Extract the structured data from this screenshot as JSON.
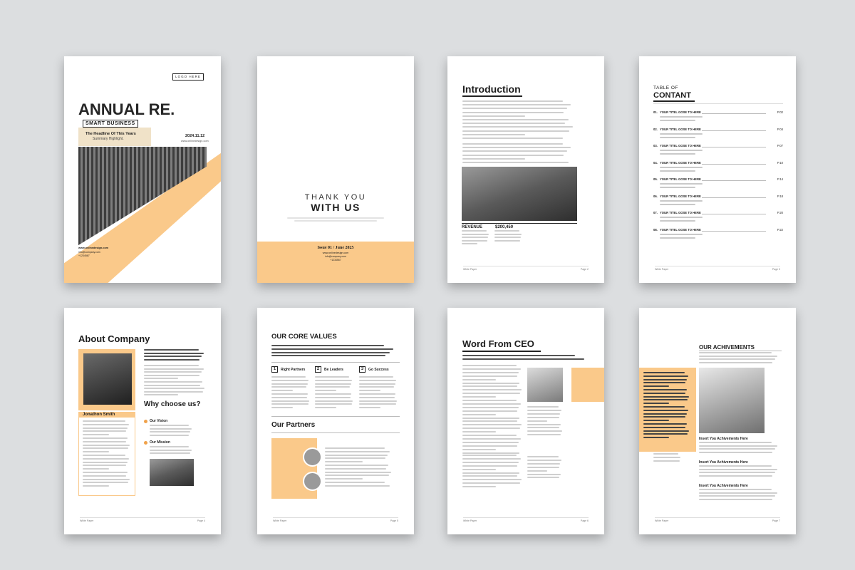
{
  "colors": {
    "accent": "#fac98a",
    "bg": "#dcdee0",
    "dark": "#1d1d1d"
  },
  "cover": {
    "logo": "LOGO HERE",
    "title": "ANNUAL RE.",
    "box_label": "SMART BUSINESS",
    "headline": "The Headline Of This Years",
    "summary": "Summary Highlight.",
    "date": "2024.11.12",
    "website": "www.onlinedesign.com",
    "contact_site": "www.onlinedesign.com",
    "contact_email": "info@company.com",
    "contact_phone": "+1234567"
  },
  "thanks": {
    "line1": "THANK YOU",
    "line2": "WITH US",
    "issue": "Issue 01 / June 2025",
    "site": "www.onlinedesign.com",
    "email": "info@company.com",
    "phone": "+1234567"
  },
  "intro": {
    "title": "Introduction",
    "revenue_label": "REVENUE",
    "revenue_value": "$200,450",
    "footer_left": "White Paper",
    "footer_right": "Page 2"
  },
  "toc": {
    "label": "TABLE OF",
    "title": "CONTANT",
    "items": [
      {
        "num": "01.",
        "title": "YOUR TITEL GOSE TO HERE",
        "page": "P.02"
      },
      {
        "num": "02.",
        "title": "YOUR TITEL GOSE TO HERE",
        "page": "P.04"
      },
      {
        "num": "03.",
        "title": "YOUR TITEL GOSE TO HERE",
        "page": "P.07"
      },
      {
        "num": "04.",
        "title": "YOUR TITEL GOSE TO HERE",
        "page": "P.10"
      },
      {
        "num": "05.",
        "title": "YOUR TITEL GOSE TO HERE",
        "page": "P.14"
      },
      {
        "num": "06.",
        "title": "YOUR TITEL GOSE TO HERE",
        "page": "P.18"
      },
      {
        "num": "07.",
        "title": "YOUR TITEL GOSE TO HERE",
        "page": "P.20"
      },
      {
        "num": "08.",
        "title": "YOUR TITEL GOSE TO HERE",
        "page": "P.22"
      }
    ],
    "footer_left": "White Paper",
    "footer_right": "Page 3"
  },
  "about": {
    "title": "About Company",
    "person": "Jonathon Smith",
    "why": "Why choose us?",
    "vision": "Our Vision",
    "mission": "Our Mission",
    "footer_left": "White Paper",
    "footer_right": "Page 4"
  },
  "values": {
    "title": "OUR CORE VALUES",
    "v1": "Right Partners",
    "v2": "Be Leaders",
    "v3": "Go Success",
    "n1": "1",
    "n2": "2",
    "n3": "3",
    "partners": "Our Partners",
    "footer_left": "White Paper",
    "footer_right": "Page 5"
  },
  "ceo": {
    "title": "Word From CEO",
    "footer_left": "White Paper",
    "footer_right": "Page 6"
  },
  "achieve": {
    "title": "OUR ACHIVEMENTS",
    "h1": "Insert You Achivements Here",
    "h2": "Insert You Achivements Here",
    "h3": "Insert You Achivements Here",
    "footer_left": "White Paper",
    "footer_right": "Page 7"
  }
}
